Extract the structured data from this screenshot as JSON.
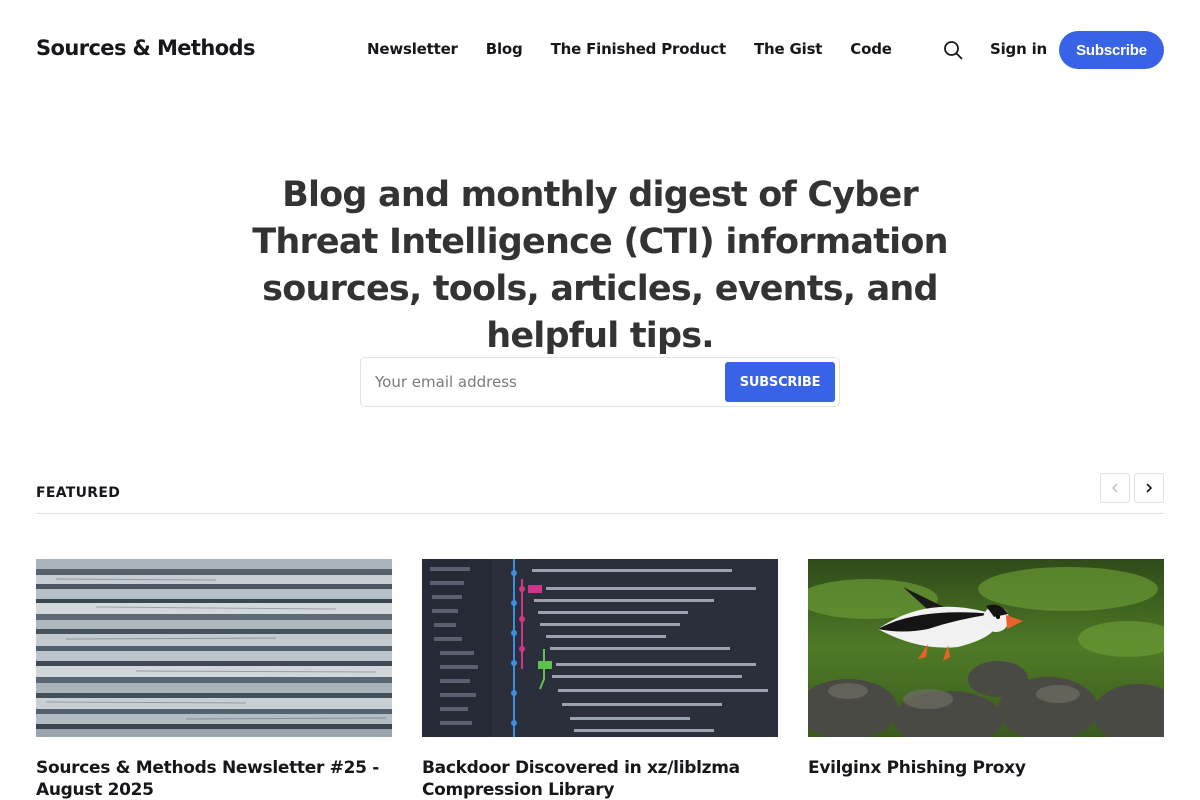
{
  "site": {
    "title": "Sources & Methods"
  },
  "nav": {
    "items": [
      "Newsletter",
      "Blog",
      "The Finished Product",
      "The Gist",
      "Code"
    ]
  },
  "header_actions": {
    "search_icon": "search-icon",
    "signin_label": "Sign in",
    "subscribe_label": "Subscribe"
  },
  "hero": {
    "title": "Blog and monthly digest of Cyber Threat Intelligence (CTI) information sources, tools, articles, events, and helpful tips."
  },
  "signup_form": {
    "placeholder": "Your email address",
    "button_label": "SUBSCRIBE"
  },
  "featured": {
    "label": "FEATURED",
    "prev_icon": "chevron-left-icon",
    "next_icon": "chevron-right-icon",
    "cards": [
      {
        "title": "Sources & Methods Newsletter #25 - August 2025"
      },
      {
        "title": "Backdoor Discovered in xz/liblzma Compression Library"
      },
      {
        "title": "Evilginx Phishing Proxy"
      }
    ]
  },
  "colors": {
    "accent": "#3863e6",
    "text": "#15171a",
    "hero_text": "#333333",
    "border": "#e3e3e3"
  }
}
